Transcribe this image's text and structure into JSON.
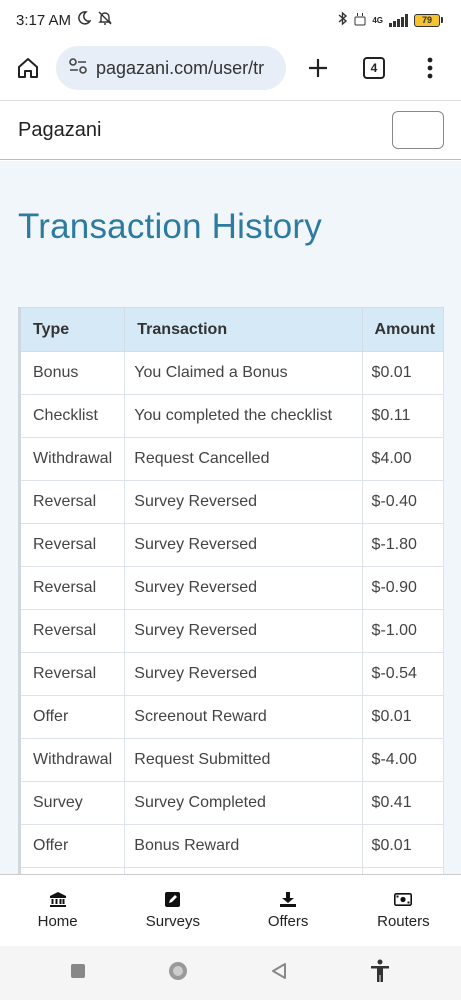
{
  "status_bar": {
    "time": "3:17 AM",
    "battery": "79",
    "network": "4G"
  },
  "browser": {
    "url": "pagazani.com/user/tr",
    "tab_count": "4"
  },
  "site": {
    "brand": "Pagazani"
  },
  "page": {
    "title": "Transaction History",
    "columns": [
      "Type",
      "Transaction",
      "Amount"
    ],
    "rows": [
      {
        "type": "Bonus",
        "transaction": "You Claimed a Bonus",
        "amount": "$0.01"
      },
      {
        "type": "Checklist",
        "transaction": "You completed the checklist",
        "amount": "$0.11"
      },
      {
        "type": "Withdrawal",
        "transaction": "Request Cancelled",
        "amount": "$4.00"
      },
      {
        "type": "Reversal",
        "transaction": "Survey Reversed",
        "amount": "$-0.40"
      },
      {
        "type": "Reversal",
        "transaction": "Survey Reversed",
        "amount": "$-1.80"
      },
      {
        "type": "Reversal",
        "transaction": "Survey Reversed",
        "amount": "$-0.90"
      },
      {
        "type": "Reversal",
        "transaction": "Survey Reversed",
        "amount": "$-1.00"
      },
      {
        "type": "Reversal",
        "transaction": "Survey Reversed",
        "amount": "$-0.54"
      },
      {
        "type": "Offer",
        "transaction": "Screenout Reward",
        "amount": "$0.01"
      },
      {
        "type": "Withdrawal",
        "transaction": "Request Submitted",
        "amount": "$-4.00"
      },
      {
        "type": "Survey",
        "transaction": "Survey Completed",
        "amount": "$0.41"
      },
      {
        "type": "Offer",
        "transaction": "Bonus Reward",
        "amount": "$0.01"
      }
    ]
  },
  "bottom_nav": {
    "items": [
      {
        "label": "Home",
        "icon": "bank-icon"
      },
      {
        "label": "Surveys",
        "icon": "edit-icon"
      },
      {
        "label": "Offers",
        "icon": "download-icon"
      },
      {
        "label": "Routers",
        "icon": "money-icon"
      }
    ]
  },
  "colors": {
    "title": "#2d7ba0",
    "table_header": "#d6e9f6",
    "content_bg": "#f1f6fa",
    "url_bar": "#e8eef7"
  }
}
